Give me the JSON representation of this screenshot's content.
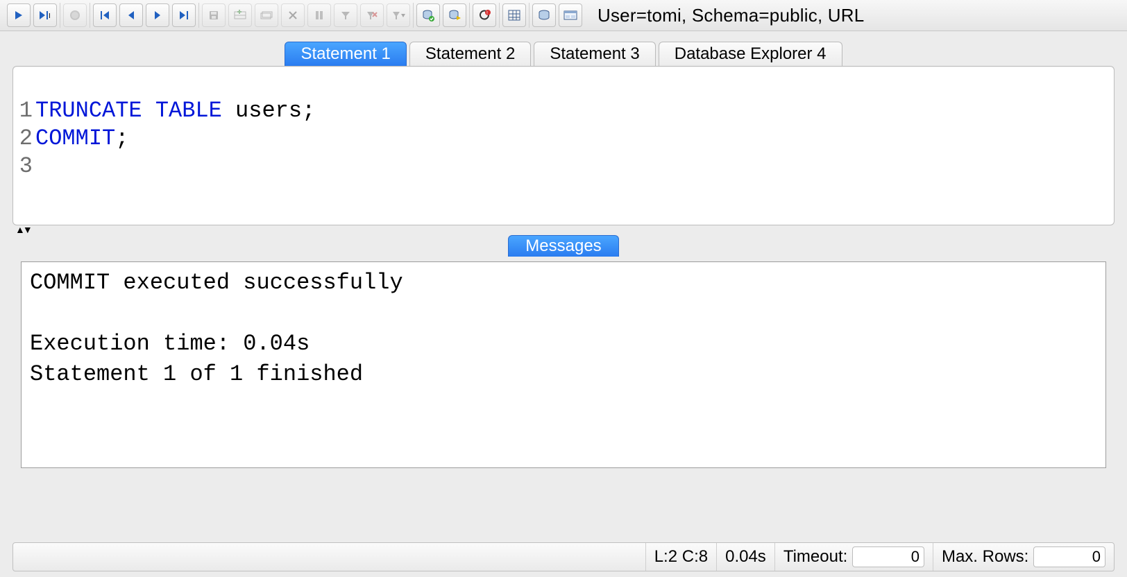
{
  "toolbar_status": "User=tomi, Schema=public, URL",
  "tabs": [
    {
      "label": "Statement 1",
      "active": true
    },
    {
      "label": "Statement 2",
      "active": false
    },
    {
      "label": "Statement 3",
      "active": false
    },
    {
      "label": "Database Explorer 4",
      "active": false
    }
  ],
  "editor": {
    "lines": [
      {
        "n": "1",
        "kw": "TRUNCATE TABLE ",
        "rest": "users;"
      },
      {
        "n": "2",
        "kw": "COMMIT",
        "rest": ";"
      },
      {
        "n": "3",
        "kw": "",
        "rest": ""
      }
    ]
  },
  "messages": {
    "tab_label": "Messages",
    "body": "COMMIT executed successfully\n\nExecution time: 0.04s\nStatement 1 of 1 finished"
  },
  "statusbar": {
    "cursor": "L:2 C:8",
    "exec_time": "0.04s",
    "timeout_label": "Timeout:",
    "timeout_value": "0",
    "maxrows_label": "Max. Rows:",
    "maxrows_value": "0"
  }
}
